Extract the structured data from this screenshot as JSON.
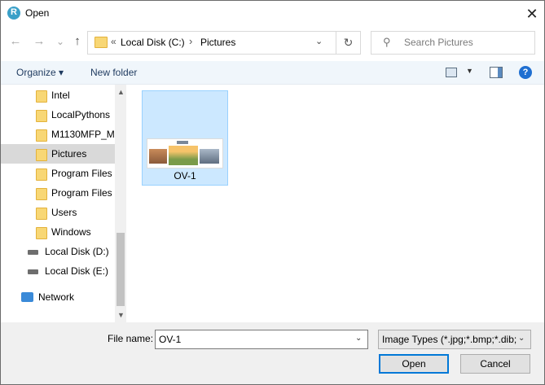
{
  "window": {
    "title": "Open",
    "app_icon": "app-logo-icon",
    "close_label": "✕"
  },
  "nav": {
    "back": "←",
    "forward": "→",
    "recent": "⌄",
    "up": "↑",
    "breadcrumb": {
      "overflow": "«",
      "segments": [
        "Local Disk (C:)",
        "Pictures"
      ],
      "separator": "›"
    },
    "search_placeholder": "Search Pictures"
  },
  "toolbar": {
    "organize_label": "Organize ▾",
    "new_folder_label": "New folder",
    "help_label": "?"
  },
  "sidebar": {
    "items": [
      {
        "label": "Intel",
        "type": "folder"
      },
      {
        "label": "LocalPythons",
        "type": "folder"
      },
      {
        "label": "M1130MFP_M",
        "type": "folder"
      },
      {
        "label": "Pictures",
        "type": "folder",
        "selected": true
      },
      {
        "label": "Program Files",
        "type": "folder"
      },
      {
        "label": "Program Files",
        "type": "folder"
      },
      {
        "label": "Users",
        "type": "folder"
      },
      {
        "label": "Windows",
        "type": "folder"
      },
      {
        "label": "Local Disk (D:)",
        "type": "drive"
      },
      {
        "label": "Local Disk (E:)",
        "type": "drive"
      },
      {
        "label": "Network",
        "type": "network"
      }
    ]
  },
  "files": [
    {
      "name": "OV-1",
      "selected": true
    }
  ],
  "bottom": {
    "file_name_label": "File name:",
    "file_name_value": "OV-1",
    "file_type_value": "Image Types (*.jpg;*.bmp;*.dib;",
    "open_label": "Open",
    "cancel_label": "Cancel"
  },
  "colors": {
    "selection_fill": "#cce8ff",
    "selection_border": "#99d1ff",
    "accent": "#0078d7",
    "folder": "#f8d775"
  }
}
